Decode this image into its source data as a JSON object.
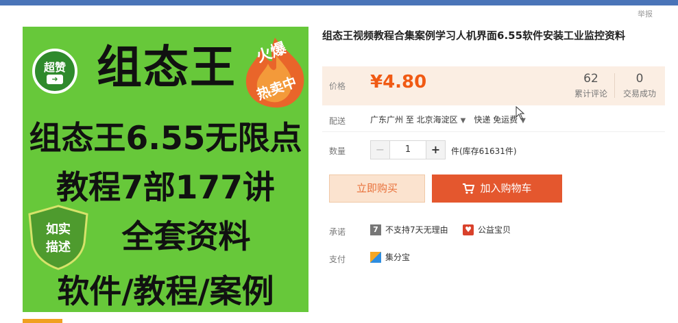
{
  "header": {
    "report_label": "举报"
  },
  "image": {
    "badge": "超赞",
    "badge_arrow": "➜",
    "brand": "组态王",
    "hot_line1": "火爆",
    "hot_line2": "热卖中",
    "line1": "组态王6.55无限点",
    "line2": "教程7部177讲",
    "line3": "全套资料",
    "line4": "软件/教程/案例",
    "shield_line1": "如实",
    "shield_line2": "描述"
  },
  "product": {
    "title": "组态王视频教程合集案例学习人机界面6.55软件安装工业监控资料",
    "price_label": "价格",
    "price": "¥4.80",
    "reviews_count": "62",
    "reviews_label": "累计评论",
    "sales_count": "0",
    "sales_label": "交易成功"
  },
  "delivery": {
    "label": "配送",
    "route": "广东广州 至  北京海淀区",
    "shipping": "快递 免运费"
  },
  "quantity": {
    "label": "数量",
    "minus": "−",
    "value": "1",
    "plus": "+",
    "stock": "件(库存61631件)"
  },
  "actions": {
    "buy_now": "立即购买",
    "add_to_cart": "加入购物车"
  },
  "promise": {
    "label": "承诺",
    "item1": "不支持7天无理由",
    "item1_icon": "7",
    "item2": "公益宝贝",
    "item2_icon": "♥"
  },
  "payment": {
    "label": "支付",
    "method": "集分宝"
  },
  "colors": {
    "top_bar": "#4a74b8",
    "image_bg": "#67c83a",
    "price": "#f05a14",
    "add_cart_bg": "#e4572e",
    "buy_now_bg": "#fbe3cf"
  }
}
